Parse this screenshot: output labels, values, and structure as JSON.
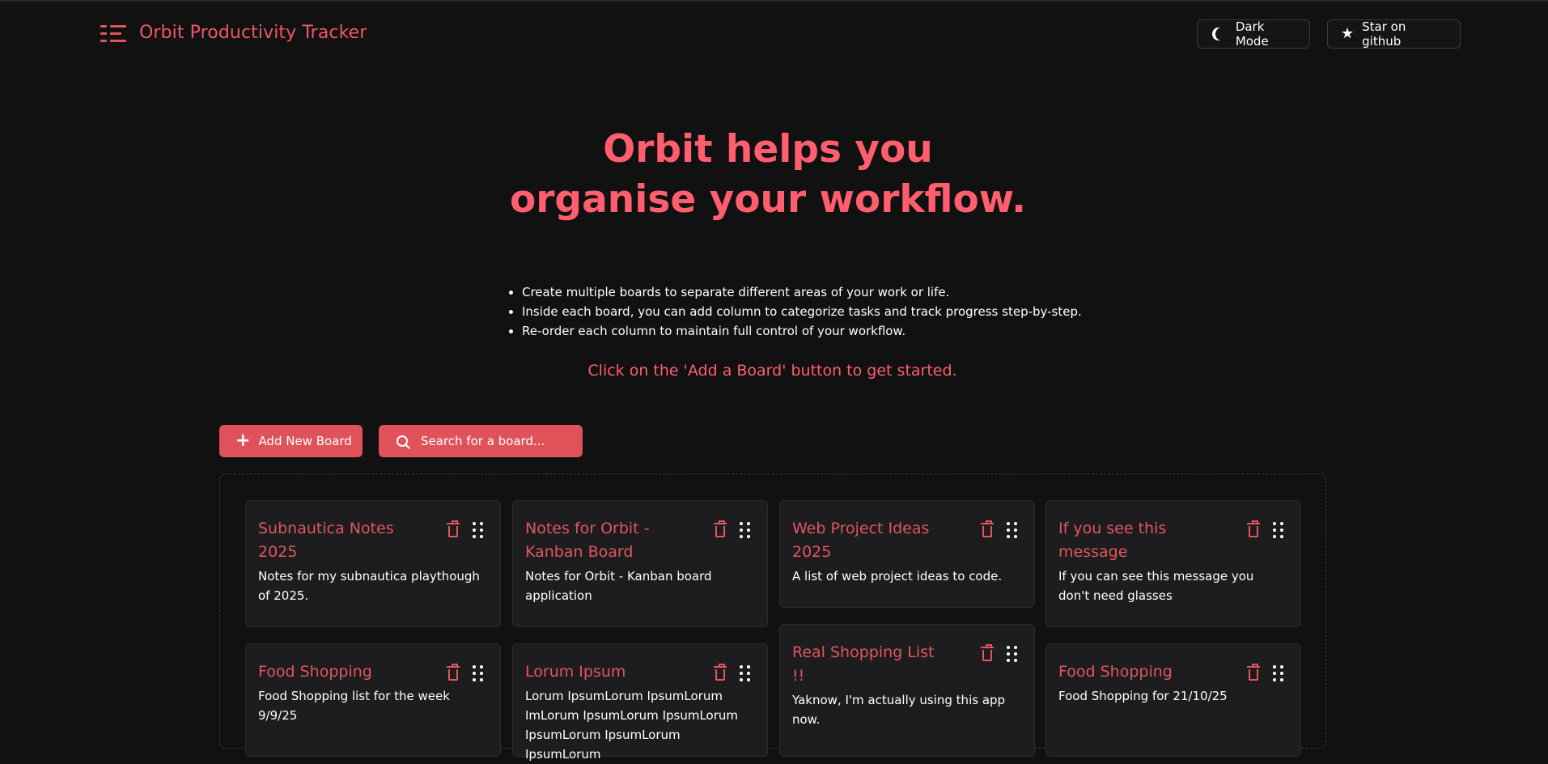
{
  "header": {
    "brand_title": "Orbit Productivity Tracker",
    "dark_mode_label": "Dark Mode",
    "github_label": "Star on github"
  },
  "hero": {
    "line1": "Orbit helps you",
    "line2": "organise your workflow."
  },
  "features": [
    "Create multiple boards to separate different areas of your work or life.",
    "Inside each board, you can add column to categorize tasks and track progress step-by-step.",
    "Re-order each column to maintain full control of your workflow."
  ],
  "cta": "Click on the 'Add a Board' button to get started.",
  "controls": {
    "add_board_label": "Add New Board",
    "search_label": "Search for a board..."
  },
  "boards": [
    {
      "title": "Subnautica Notes 2025",
      "description": "Notes for my subnautica playthough of 2025."
    },
    {
      "title": "Notes for Orbit - Kanban Board",
      "description": "Notes for Orbit - Kanban board application"
    },
    {
      "title": "Web Project Ideas 2025",
      "description": "A list of web project ideas to code."
    },
    {
      "title": "If you see this message",
      "description": "If you can see this message you don't need glasses"
    },
    {
      "title": "Food Shopping",
      "description": "Food Shopping list for the week 9/9/25"
    },
    {
      "title": "Lorum Ipsum",
      "description": "Lorum IpsumLorum IpsumLorum ImLorum IpsumLorum IpsumLorum IpsumLorum IpsumLorum IpsumLorum"
    },
    {
      "title": "Real Shopping List !!",
      "description": "Yaknow, I'm actually using this app now."
    },
    {
      "title": "Food Shopping",
      "description": "Food Shopping for 21/10/25"
    }
  ],
  "colors": {
    "accent": "#ff5e6e",
    "button": "#e0525a",
    "card_bg": "#1d1d20",
    "page_bg": "#111112"
  },
  "icons": {
    "brand": "list-icon",
    "dark_mode": "moon-icon",
    "github": "star-icon",
    "add": "plus-icon",
    "search": "search-icon",
    "delete": "trash-icon",
    "drag": "grip-icon"
  }
}
